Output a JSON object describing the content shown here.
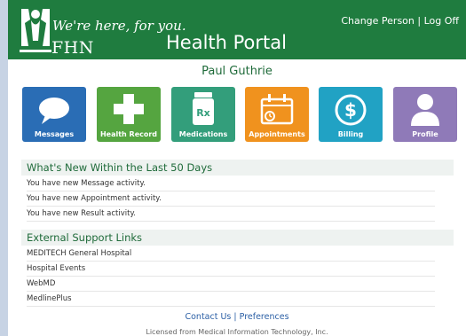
{
  "header": {
    "tagline": "We're here, for you.",
    "brand": "FHN",
    "app_title": "Health Portal",
    "change_person": "Change Person",
    "separator": "|",
    "log_off": "Log Off"
  },
  "user": {
    "name": "Paul Guthrie"
  },
  "tiles": [
    {
      "label": "Messages",
      "icon": "speech-bubble-icon",
      "color": "#2a6db5"
    },
    {
      "label": "Health Record",
      "icon": "medical-cross-icon",
      "color": "#55a540"
    },
    {
      "label": "Medications",
      "icon": "rx-bottle-icon",
      "color": "#339e7b"
    },
    {
      "label": "Appointments",
      "icon": "calendar-icon",
      "color": "#f0921e"
    },
    {
      "label": "Billing",
      "icon": "dollar-icon",
      "color": "#21a2c4"
    },
    {
      "label": "Profile",
      "icon": "person-icon",
      "color": "#8f7ab8"
    }
  ],
  "whats_new": {
    "heading": "What's New Within the Last 50 Days",
    "items": [
      "You have new Message activity.",
      "You have new Appointment activity.",
      "You have new Result activity."
    ]
  },
  "support": {
    "heading": "External Support Links",
    "links": [
      "MEDITECH General Hospital",
      "Hospital Events",
      "WebMD",
      "MedlinePlus"
    ]
  },
  "footer": {
    "contact": "Contact Us",
    "separator": "|",
    "preferences": "Preferences",
    "license": "Licensed from Medical Information Technology, Inc."
  },
  "colors": {
    "header_green": "#1f7c3f",
    "accent_green": "#1f6b3a",
    "link_blue": "#2b5fa5",
    "left_rail": "#c7d3e4"
  }
}
